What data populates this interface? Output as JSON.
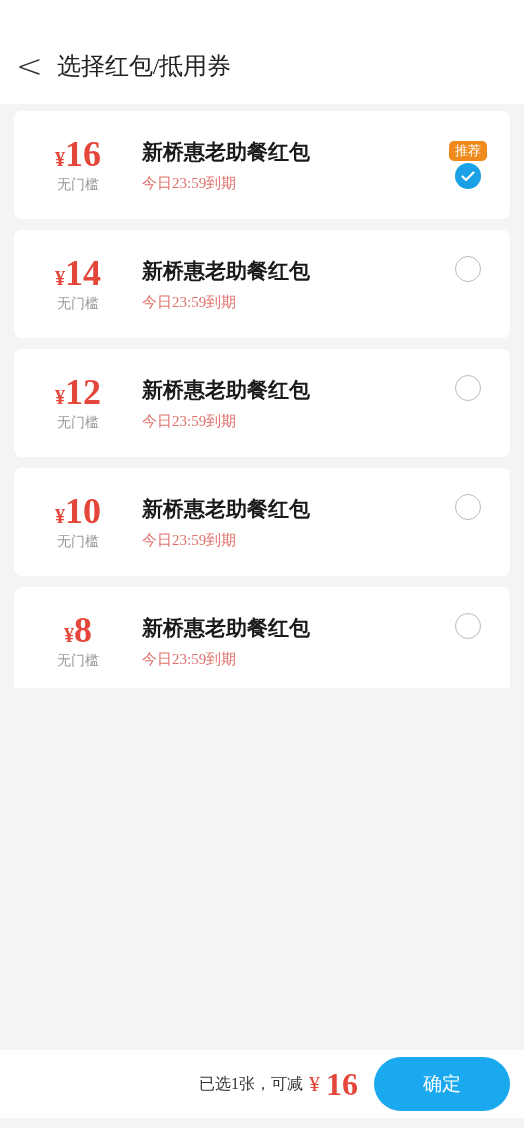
{
  "header": {
    "back": "<",
    "title": "选择红包/抵用券"
  },
  "coupons": [
    {
      "currency": "¥",
      "amount": "16",
      "condition": "无门槛",
      "name": "新桥惠老助餐红包",
      "expiry": "今日23:59到期",
      "badge": "推荐",
      "selected": true
    },
    {
      "currency": "¥",
      "amount": "14",
      "condition": "无门槛",
      "name": "新桥惠老助餐红包",
      "expiry": "今日23:59到期",
      "selected": false
    },
    {
      "currency": "¥",
      "amount": "12",
      "condition": "无门槛",
      "name": "新桥惠老助餐红包",
      "expiry": "今日23:59到期",
      "selected": false
    },
    {
      "currency": "¥",
      "amount": "10",
      "condition": "无门槛",
      "name": "新桥惠老助餐红包",
      "expiry": "今日23:59到期",
      "selected": false
    },
    {
      "currency": "¥",
      "amount": "8",
      "condition": "无门槛",
      "name": "新桥惠老助餐红包",
      "expiry": "今日23:59到期",
      "selected": false
    }
  ],
  "footer": {
    "summary": "已选1张，可减",
    "currency": "¥",
    "amount": "16",
    "confirm": "确定"
  }
}
